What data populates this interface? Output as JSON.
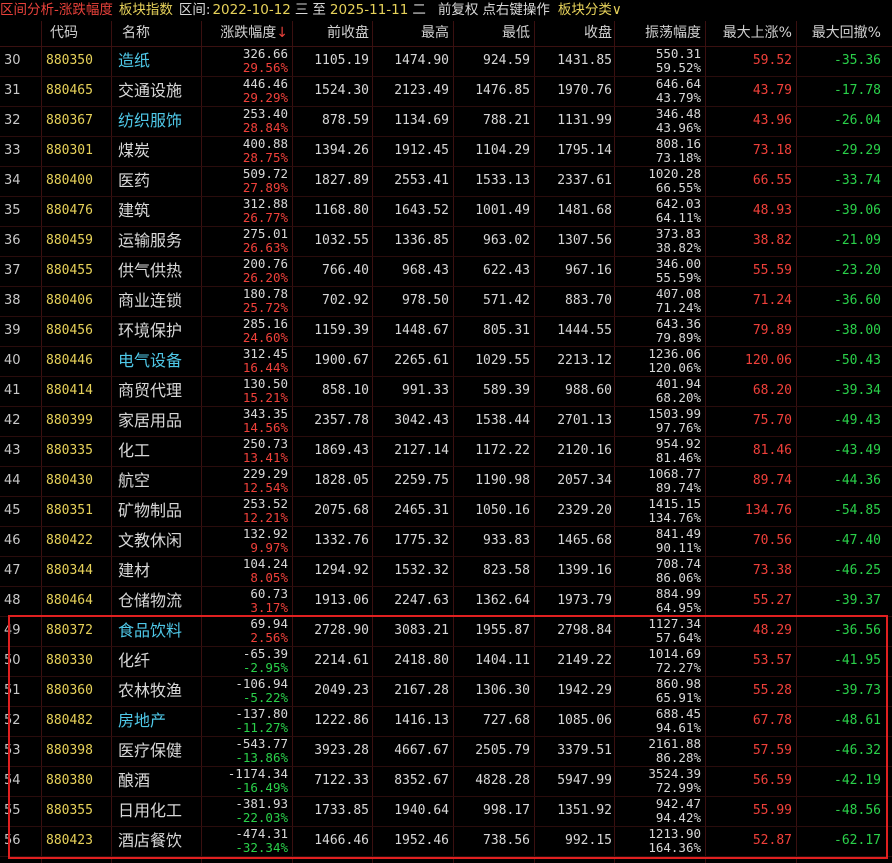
{
  "topbar": {
    "title": "区间分析-涨跌幅度",
    "index_type": "板块指数",
    "range_label": "区间:",
    "start_date": "2022-10-12",
    "start_weekday": "三",
    "to": "至",
    "end_date": "2025-11-11",
    "end_weekday": "二",
    "adjust": "前复权",
    "hint": "点右键操作",
    "category": "板块分类∨"
  },
  "header": {
    "code": "代码",
    "name": "名称",
    "change": "涨跌幅度",
    "sort_arrow": "↓",
    "prev_close": "前收盘",
    "high": "最高",
    "low": "最低",
    "close": "收盘",
    "amplitude": "振荡幅度",
    "max_up": "最大上涨%",
    "max_drawdown": "最大回撤%"
  },
  "colors": {
    "up": "#f0403a",
    "down": "#2ad14a",
    "code": "#e7d25a",
    "highlight_name": "#4fc8e8",
    "selection_box": "#e02020"
  },
  "rows": [
    {
      "idx": "30",
      "code": "880350",
      "name": "造纸",
      "cyan": true,
      "chg": "326.66",
      "pct": "29.56%",
      "prev": "1105.19",
      "high": "1474.90",
      "low": "924.59",
      "close": "1431.85",
      "amp": "550.31",
      "amp_pct": "59.52%",
      "up": "59.52",
      "dd": "-35.36"
    },
    {
      "idx": "31",
      "code": "880465",
      "name": "交通设施",
      "cyan": false,
      "chg": "446.46",
      "pct": "29.29%",
      "prev": "1524.30",
      "high": "2123.49",
      "low": "1476.85",
      "close": "1970.76",
      "amp": "646.64",
      "amp_pct": "43.79%",
      "up": "43.79",
      "dd": "-17.78"
    },
    {
      "idx": "32",
      "code": "880367",
      "name": "纺织服饰",
      "cyan": true,
      "chg": "253.40",
      "pct": "28.84%",
      "prev": "878.59",
      "high": "1134.69",
      "low": "788.21",
      "close": "1131.99",
      "amp": "346.48",
      "amp_pct": "43.96%",
      "up": "43.96",
      "dd": "-26.04"
    },
    {
      "idx": "33",
      "code": "880301",
      "name": "煤炭",
      "cyan": false,
      "chg": "400.88",
      "pct": "28.75%",
      "prev": "1394.26",
      "high": "1912.45",
      "low": "1104.29",
      "close": "1795.14",
      "amp": "808.16",
      "amp_pct": "73.18%",
      "up": "73.18",
      "dd": "-29.29"
    },
    {
      "idx": "34",
      "code": "880400",
      "name": "医药",
      "cyan": false,
      "chg": "509.72",
      "pct": "27.89%",
      "prev": "1827.89",
      "high": "2553.41",
      "low": "1533.13",
      "close": "2337.61",
      "amp": "1020.28",
      "amp_pct": "66.55%",
      "up": "66.55",
      "dd": "-33.74"
    },
    {
      "idx": "35",
      "code": "880476",
      "name": "建筑",
      "cyan": false,
      "chg": "312.88",
      "pct": "26.77%",
      "prev": "1168.80",
      "high": "1643.52",
      "low": "1001.49",
      "close": "1481.68",
      "amp": "642.03",
      "amp_pct": "64.11%",
      "up": "48.93",
      "dd": "-39.06"
    },
    {
      "idx": "36",
      "code": "880459",
      "name": "运输服务",
      "cyan": false,
      "chg": "275.01",
      "pct": "26.63%",
      "prev": "1032.55",
      "high": "1336.85",
      "low": "963.02",
      "close": "1307.56",
      "amp": "373.83",
      "amp_pct": "38.82%",
      "up": "38.82",
      "dd": "-21.09"
    },
    {
      "idx": "37",
      "code": "880455",
      "name": "供气供热",
      "cyan": false,
      "chg": "200.76",
      "pct": "26.20%",
      "prev": "766.40",
      "high": "968.43",
      "low": "622.43",
      "close": "967.16",
      "amp": "346.00",
      "amp_pct": "55.59%",
      "up": "55.59",
      "dd": "-23.20"
    },
    {
      "idx": "38",
      "code": "880406",
      "name": "商业连锁",
      "cyan": false,
      "chg": "180.78",
      "pct": "25.72%",
      "prev": "702.92",
      "high": "978.50",
      "low": "571.42",
      "close": "883.70",
      "amp": "407.08",
      "amp_pct": "71.24%",
      "up": "71.24",
      "dd": "-36.60"
    },
    {
      "idx": "39",
      "code": "880456",
      "name": "环境保护",
      "cyan": false,
      "chg": "285.16",
      "pct": "24.60%",
      "prev": "1159.39",
      "high": "1448.67",
      "low": "805.31",
      "close": "1444.55",
      "amp": "643.36",
      "amp_pct": "79.89%",
      "up": "79.89",
      "dd": "-38.00"
    },
    {
      "idx": "40",
      "code": "880446",
      "name": "电气设备",
      "cyan": true,
      "chg": "312.45",
      "pct": "16.44%",
      "prev": "1900.67",
      "high": "2265.61",
      "low": "1029.55",
      "close": "2213.12",
      "amp": "1236.06",
      "amp_pct": "120.06%",
      "up": "120.06",
      "dd": "-50.43"
    },
    {
      "idx": "41",
      "code": "880414",
      "name": "商贸代理",
      "cyan": false,
      "chg": "130.50",
      "pct": "15.21%",
      "prev": "858.10",
      "high": "991.33",
      "low": "589.39",
      "close": "988.60",
      "amp": "401.94",
      "amp_pct": "68.20%",
      "up": "68.20",
      "dd": "-39.34"
    },
    {
      "idx": "42",
      "code": "880399",
      "name": "家居用品",
      "cyan": false,
      "chg": "343.35",
      "pct": "14.56%",
      "prev": "2357.78",
      "high": "3042.43",
      "low": "1538.44",
      "close": "2701.13",
      "amp": "1503.99",
      "amp_pct": "97.76%",
      "up": "75.70",
      "dd": "-49.43"
    },
    {
      "idx": "43",
      "code": "880335",
      "name": "化工",
      "cyan": false,
      "chg": "250.73",
      "pct": "13.41%",
      "prev": "1869.43",
      "high": "2127.14",
      "low": "1172.22",
      "close": "2120.16",
      "amp": "954.92",
      "amp_pct": "81.46%",
      "up": "81.46",
      "dd": "-43.49"
    },
    {
      "idx": "44",
      "code": "880430",
      "name": "航空",
      "cyan": false,
      "chg": "229.29",
      "pct": "12.54%",
      "prev": "1828.05",
      "high": "2259.75",
      "low": "1190.98",
      "close": "2057.34",
      "amp": "1068.77",
      "amp_pct": "89.74%",
      "up": "89.74",
      "dd": "-44.36"
    },
    {
      "idx": "45",
      "code": "880351",
      "name": "矿物制品",
      "cyan": false,
      "chg": "253.52",
      "pct": "12.21%",
      "prev": "2075.68",
      "high": "2465.31",
      "low": "1050.16",
      "close": "2329.20",
      "amp": "1415.15",
      "amp_pct": "134.76%",
      "up": "134.76",
      "dd": "-54.85"
    },
    {
      "idx": "46",
      "code": "880422",
      "name": "文教休闲",
      "cyan": false,
      "chg": "132.92",
      "pct": "9.97%",
      "prev": "1332.76",
      "high": "1775.32",
      "low": "933.83",
      "close": "1465.68",
      "amp": "841.49",
      "amp_pct": "90.11%",
      "up": "70.56",
      "dd": "-47.40"
    },
    {
      "idx": "47",
      "code": "880344",
      "name": "建材",
      "cyan": false,
      "chg": "104.24",
      "pct": "8.05%",
      "prev": "1294.92",
      "high": "1532.32",
      "low": "823.58",
      "close": "1399.16",
      "amp": "708.74",
      "amp_pct": "86.06%",
      "up": "73.38",
      "dd": "-46.25"
    },
    {
      "idx": "48",
      "code": "880464",
      "name": "仓储物流",
      "cyan": false,
      "chg": "60.73",
      "pct": "3.17%",
      "prev": "1913.06",
      "high": "2247.63",
      "low": "1362.64",
      "close": "1973.79",
      "amp": "884.99",
      "amp_pct": "64.95%",
      "up": "55.27",
      "dd": "-39.37"
    },
    {
      "idx": "49",
      "code": "880372",
      "name": "食品饮料",
      "cyan": true,
      "chg": "69.94",
      "pct": "2.56%",
      "prev": "2728.90",
      "high": "3083.21",
      "low": "1955.87",
      "close": "2798.84",
      "amp": "1127.34",
      "amp_pct": "57.64%",
      "up": "48.29",
      "dd": "-36.56"
    },
    {
      "idx": "50",
      "code": "880330",
      "name": "化纤",
      "cyan": false,
      "chg": "-65.39",
      "pct": "-2.95%",
      "prev": "2214.61",
      "high": "2418.80",
      "low": "1404.11",
      "close": "2149.22",
      "amp": "1014.69",
      "amp_pct": "72.27%",
      "up": "53.57",
      "dd": "-41.95"
    },
    {
      "idx": "51",
      "code": "880360",
      "name": "农林牧渔",
      "cyan": false,
      "chg": "-106.94",
      "pct": "-5.22%",
      "prev": "2049.23",
      "high": "2167.28",
      "low": "1306.30",
      "close": "1942.29",
      "amp": "860.98",
      "amp_pct": "65.91%",
      "up": "55.28",
      "dd": "-39.73"
    },
    {
      "idx": "52",
      "code": "880482",
      "name": "房地产",
      "cyan": true,
      "chg": "-137.80",
      "pct": "-11.27%",
      "prev": "1222.86",
      "high": "1416.13",
      "low": "727.68",
      "close": "1085.06",
      "amp": "688.45",
      "amp_pct": "94.61%",
      "up": "67.78",
      "dd": "-48.61"
    },
    {
      "idx": "53",
      "code": "880398",
      "name": "医疗保健",
      "cyan": false,
      "chg": "-543.77",
      "pct": "-13.86%",
      "prev": "3923.28",
      "high": "4667.67",
      "low": "2505.79",
      "close": "3379.51",
      "amp": "2161.88",
      "amp_pct": "86.28%",
      "up": "57.59",
      "dd": "-46.32"
    },
    {
      "idx": "54",
      "code": "880380",
      "name": "酿酒",
      "cyan": false,
      "chg": "-1174.34",
      "pct": "-16.49%",
      "prev": "7122.33",
      "high": "8352.67",
      "low": "4828.28",
      "close": "5947.99",
      "amp": "3524.39",
      "amp_pct": "72.99%",
      "up": "56.59",
      "dd": "-42.19"
    },
    {
      "idx": "55",
      "code": "880355",
      "name": "日用化工",
      "cyan": false,
      "chg": "-381.93",
      "pct": "-22.03%",
      "prev": "1733.85",
      "high": "1940.64",
      "low": "998.17",
      "close": "1351.92",
      "amp": "942.47",
      "amp_pct": "94.42%",
      "up": "55.99",
      "dd": "-48.56"
    },
    {
      "idx": "56",
      "code": "880423",
      "name": "酒店餐饮",
      "cyan": false,
      "chg": "-474.31",
      "pct": "-32.34%",
      "prev": "1466.46",
      "high": "1952.46",
      "low": "738.56",
      "close": "992.15",
      "amp": "1213.90",
      "amp_pct": "164.36%",
      "up": "52.87",
      "dd": "-62.17"
    }
  ]
}
